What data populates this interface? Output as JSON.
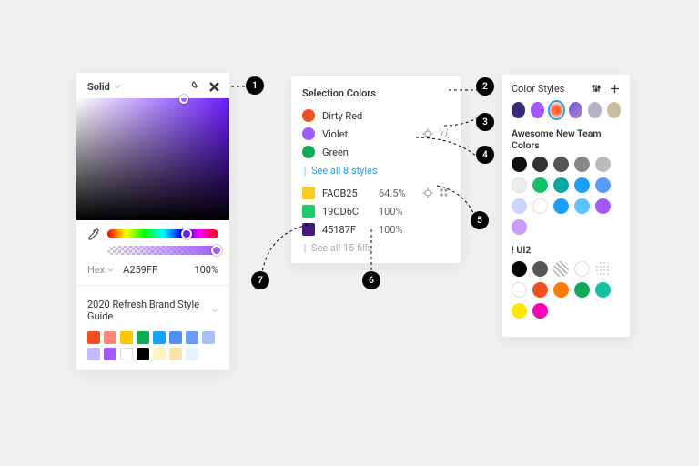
{
  "picker": {
    "mode_label": "Solid",
    "hex_mode_label": "Hex",
    "hex_value": "A259FF",
    "opacity": "100%",
    "library_title": "2020 Refresh Brand Style Guide",
    "swatches": [
      "#F24E1E",
      "#FF8577",
      "#FFC700",
      "#0FA958",
      "#18A0fb",
      "#4F8FF7",
      "#699BF7",
      "#A7C0F8",
      "#C7B9FF",
      "#A259FF",
      "#ffffff",
      "#000000",
      "#FFF3C7",
      "#FFE1A8",
      "#E3F3FF"
    ]
  },
  "selection": {
    "title": "Selection Colors",
    "colors": [
      {
        "name": "Dirty Red",
        "hex": "#F24E1E"
      },
      {
        "name": "Violet",
        "hex": "#A259FF"
      },
      {
        "name": "Green",
        "hex": "#0FA958"
      }
    ],
    "see_styles": "See all 8 styles",
    "fills": [
      {
        "hex": "FACB25",
        "pct": "64.5%",
        "chip": "#FACB25"
      },
      {
        "hex": "19CD6C",
        "pct": "100%",
        "chip": "#19CD6C"
      },
      {
        "hex": "45187F",
        "pct": "100%",
        "chip": "#45187F"
      }
    ],
    "see_fills": "See all 15 fills"
  },
  "styles": {
    "title": "Color Styles",
    "thumbs": [
      {
        "bg": "#3b2a7a"
      },
      {
        "bg": "#A259FF"
      },
      {
        "bg": "radial-gradient(circle,#ff6a3d 35%,#ffd9c9 70%)",
        "selected": true
      },
      {
        "bg": "linear-gradient(135deg,#6b5bd4,#b67bd4)"
      },
      {
        "bg": "#b8b0c9"
      },
      {
        "bg": "#cbbf9b"
      }
    ],
    "group1_title": "Awesome New Team Colors",
    "group1": [
      "#111",
      "#333",
      "#555",
      "#888",
      "#bbb",
      "#eee",
      "#13c16b",
      "#0aa7a0",
      "#18a0fb",
      "#5a99ff",
      "#c9d4ff",
      "#ffffff",
      "#18a0fb",
      "#5ec2ff",
      "#A259FF",
      "#c89cff"
    ],
    "group2_title": "! UI2",
    "group2": [
      "#000",
      "#555",
      "pattern-stripe",
      "outline",
      "pattern-dots",
      "outline",
      "#F24E1E",
      "#ff7a00",
      "#0FA958",
      "#13c1a4",
      "#ffe600",
      "#ff00b8"
    ]
  },
  "callouts": [
    "1",
    "2",
    "3",
    "4",
    "5",
    "6",
    "7"
  ]
}
